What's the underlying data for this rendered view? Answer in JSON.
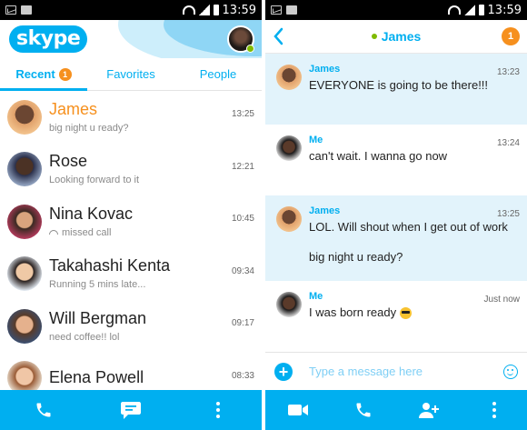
{
  "status_bar": {
    "time": "13:59"
  },
  "home": {
    "tabs": [
      {
        "label": "Recent",
        "badge": "1"
      },
      {
        "label": "Favorites"
      },
      {
        "label": "People"
      }
    ],
    "contacts": [
      {
        "name": "James",
        "subtitle": "big night u ready?",
        "time": "13:25",
        "unread": true
      },
      {
        "name": "Rose",
        "subtitle": "Looking forward to it",
        "time": "12:21"
      },
      {
        "name": "Nina Kovac",
        "subtitle": "missed call",
        "time": "10:45",
        "missed_call": true
      },
      {
        "name": "Takahashi Kenta",
        "subtitle": "Running 5 mins late...",
        "time": "09:34"
      },
      {
        "name": "Will Bergman",
        "subtitle": "need coffee!! lol",
        "time": "09:17"
      },
      {
        "name": "Elena Powell",
        "subtitle": "",
        "time": "08:33"
      }
    ],
    "logo": "skype"
  },
  "chat": {
    "title": "James",
    "badge": "1",
    "back_icon": "chevron-left-icon",
    "messages": [
      {
        "sender": "James",
        "time": "13:23",
        "text": "EVERYONE is going to be there!!!",
        "incoming": true
      },
      {
        "sender": "Me",
        "time": "13:24",
        "text": "can't wait. I wanna go now",
        "incoming": false
      },
      {
        "sender": "James",
        "time": "13:25",
        "text": "LOL. Will shout when I get out of work",
        "text2": "big night u ready?",
        "incoming": true
      },
      {
        "sender": "Me",
        "time": "Just now",
        "text": "I was born ready",
        "emoji": "sunglasses-emoji",
        "incoming": false
      }
    ],
    "composer": {
      "placeholder": "Type a message here",
      "value": ""
    }
  },
  "colors": {
    "accent": "#00aff0",
    "unread": "#f6901e",
    "online": "#7fba00",
    "incoming_bg": "#e2f3fb"
  }
}
